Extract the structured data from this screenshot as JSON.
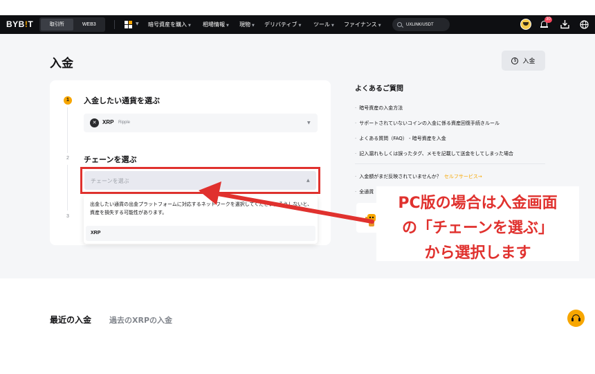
{
  "navbar": {
    "logo_prefix": "BYB",
    "logo_accent": "!",
    "logo_suffix": "T",
    "switch_exchange": "取引所",
    "switch_web3": "WEB3",
    "menu": [
      {
        "label": "暗号資産を購入"
      },
      {
        "label": "相場情報"
      },
      {
        "label": "現物"
      },
      {
        "label": "デリバティブ"
      },
      {
        "label": "ツール"
      },
      {
        "label": "ファイナンス"
      }
    ],
    "search_value": "UXLINK/USDT",
    "notification_count": "30"
  },
  "page": {
    "title": "入金",
    "deposit_button": "入金",
    "coin_glyph": "$"
  },
  "steps": {
    "step1": {
      "number": "1",
      "title": "入金したい通貨を選ぶ"
    },
    "step2": {
      "number": "2",
      "title": "チェーンを選ぶ"
    },
    "step3": {
      "number": "3"
    }
  },
  "coin_select": {
    "symbol": "XRP",
    "name": "Ripple",
    "icon_glyph": "✕"
  },
  "chain_select": {
    "placeholder": "チェーンを選ぶ"
  },
  "chain_dropdown": {
    "warning": "出金したい通貨の出金プラットフォームに対応するネットワークを選択してください。そうしないと、資産を損失する可能性があります。",
    "options": [
      "XRP"
    ]
  },
  "faq": {
    "title": "よくあるご質問",
    "items": [
      "暗号資産の入金方法",
      "サポートされていないコインの入金に係る資産回復手続きルール",
      "よくある質問（FAQ） - 暗号資産を入金",
      "記入漏れもしくは誤ったタグ、メモを記載して送金をしてしまった場合",
      "入金額がまだ反映されていませんか？",
      "全通貨"
    ],
    "self_service_link": "セルフサービス→"
  },
  "annotation": {
    "line1": "PC版の場合は入金画面",
    "line2": "の「チェーンを選ぶ」",
    "line3": "から選択します",
    "color": "#e0312e"
  },
  "recent": {
    "title": "最近の入金",
    "subtitle": "過去のXRPの入金"
  },
  "colors": {
    "brand": "#f7a600",
    "annotation_red": "#e0312e",
    "navbar": "#0e0f12"
  }
}
